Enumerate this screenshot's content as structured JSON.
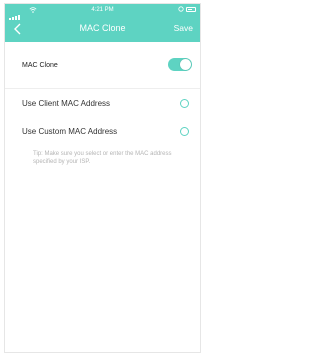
{
  "statusbar": {
    "time": "4:21 PM"
  },
  "header": {
    "title": "MAC Clone",
    "save_label": "Save",
    "color": "#5ed3c2"
  },
  "mac_clone": {
    "label": "MAC Clone",
    "enabled": true
  },
  "options": [
    {
      "label": "Use Client MAC Address",
      "selected": false
    },
    {
      "label": "Use Custom MAC Address",
      "selected": false
    }
  ],
  "tip": "Tip: Make sure you select or enter the MAC address specified by your ISP."
}
